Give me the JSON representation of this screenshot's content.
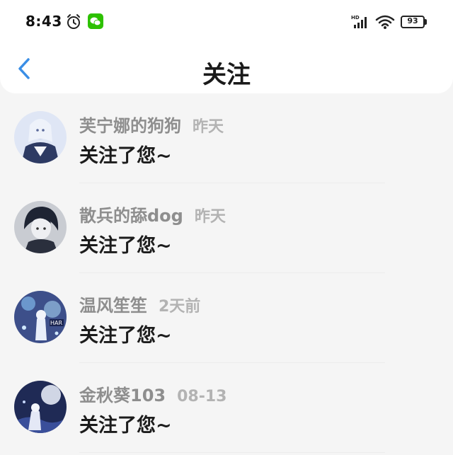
{
  "status_bar": {
    "time": "8:43",
    "battery": "93",
    "icons": [
      "alarm-icon",
      "wechat-icon",
      "signal-icon",
      "wifi-icon",
      "battery-icon"
    ]
  },
  "header": {
    "title": "关注",
    "back_icon": "chevron-left-icon"
  },
  "colors": {
    "accent": "#3a8ee6",
    "background": "#f5f5f5",
    "name_gray": "#8e8e8e",
    "time_gray": "#b3b3b3",
    "wechat_green": "#2dc100"
  },
  "followers": [
    {
      "name": "芙宁娜的狗狗",
      "time": "昨天",
      "message": "关注了您~"
    },
    {
      "name": "散兵的舔dog",
      "time": "昨天",
      "message": "关注了您~"
    },
    {
      "name": "温风笙笙",
      "time": "2天前",
      "message": "关注了您~"
    },
    {
      "name": "金秋葵103",
      "time": "08-13",
      "message": "关注了您~"
    }
  ]
}
